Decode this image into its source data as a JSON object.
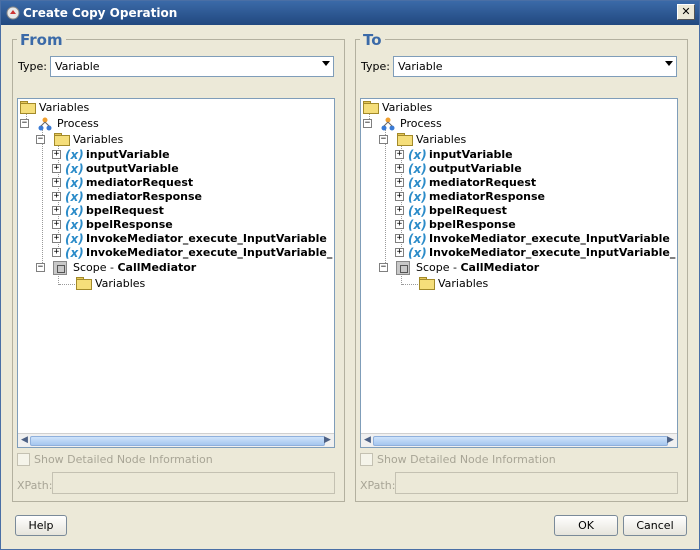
{
  "window": {
    "title": "Create Copy Operation",
    "close_glyph": "✕"
  },
  "from_panel": {
    "legend": "From",
    "type_label": "Type:",
    "type_value": "Variable",
    "show_detail_label": "Show Detailed Node Information",
    "xpath_label": "XPath:",
    "xpath_value": ""
  },
  "to_panel": {
    "legend": "To",
    "type_label": "Type:",
    "type_value": "Variable",
    "show_detail_label": "Show Detailed Node Information",
    "xpath_label": "XPath:",
    "xpath_value": ""
  },
  "tree": {
    "root": "Variables",
    "process": "Process",
    "process_variables": "Variables",
    "variables": [
      "inputVariable",
      "outputVariable",
      "mediatorRequest",
      "mediatorResponse",
      "bpelRequest",
      "bpelResponse",
      "InvokeMediator_execute_InputVariable",
      "InvokeMediator_execute_InputVariable_"
    ],
    "scope_prefix": "Scope - ",
    "scope_name": "CallMediator",
    "scope_variables": "Variables",
    "var_icon_glyph": "(x)",
    "expand_glyph": "+",
    "collapse_glyph": "−"
  },
  "buttons": {
    "help": "Help",
    "ok": "OK",
    "cancel": "Cancel"
  },
  "colors": {
    "accent": "#3b6aa8",
    "variable_icon": "#2c8cc9",
    "folder": "#f5de7a"
  }
}
